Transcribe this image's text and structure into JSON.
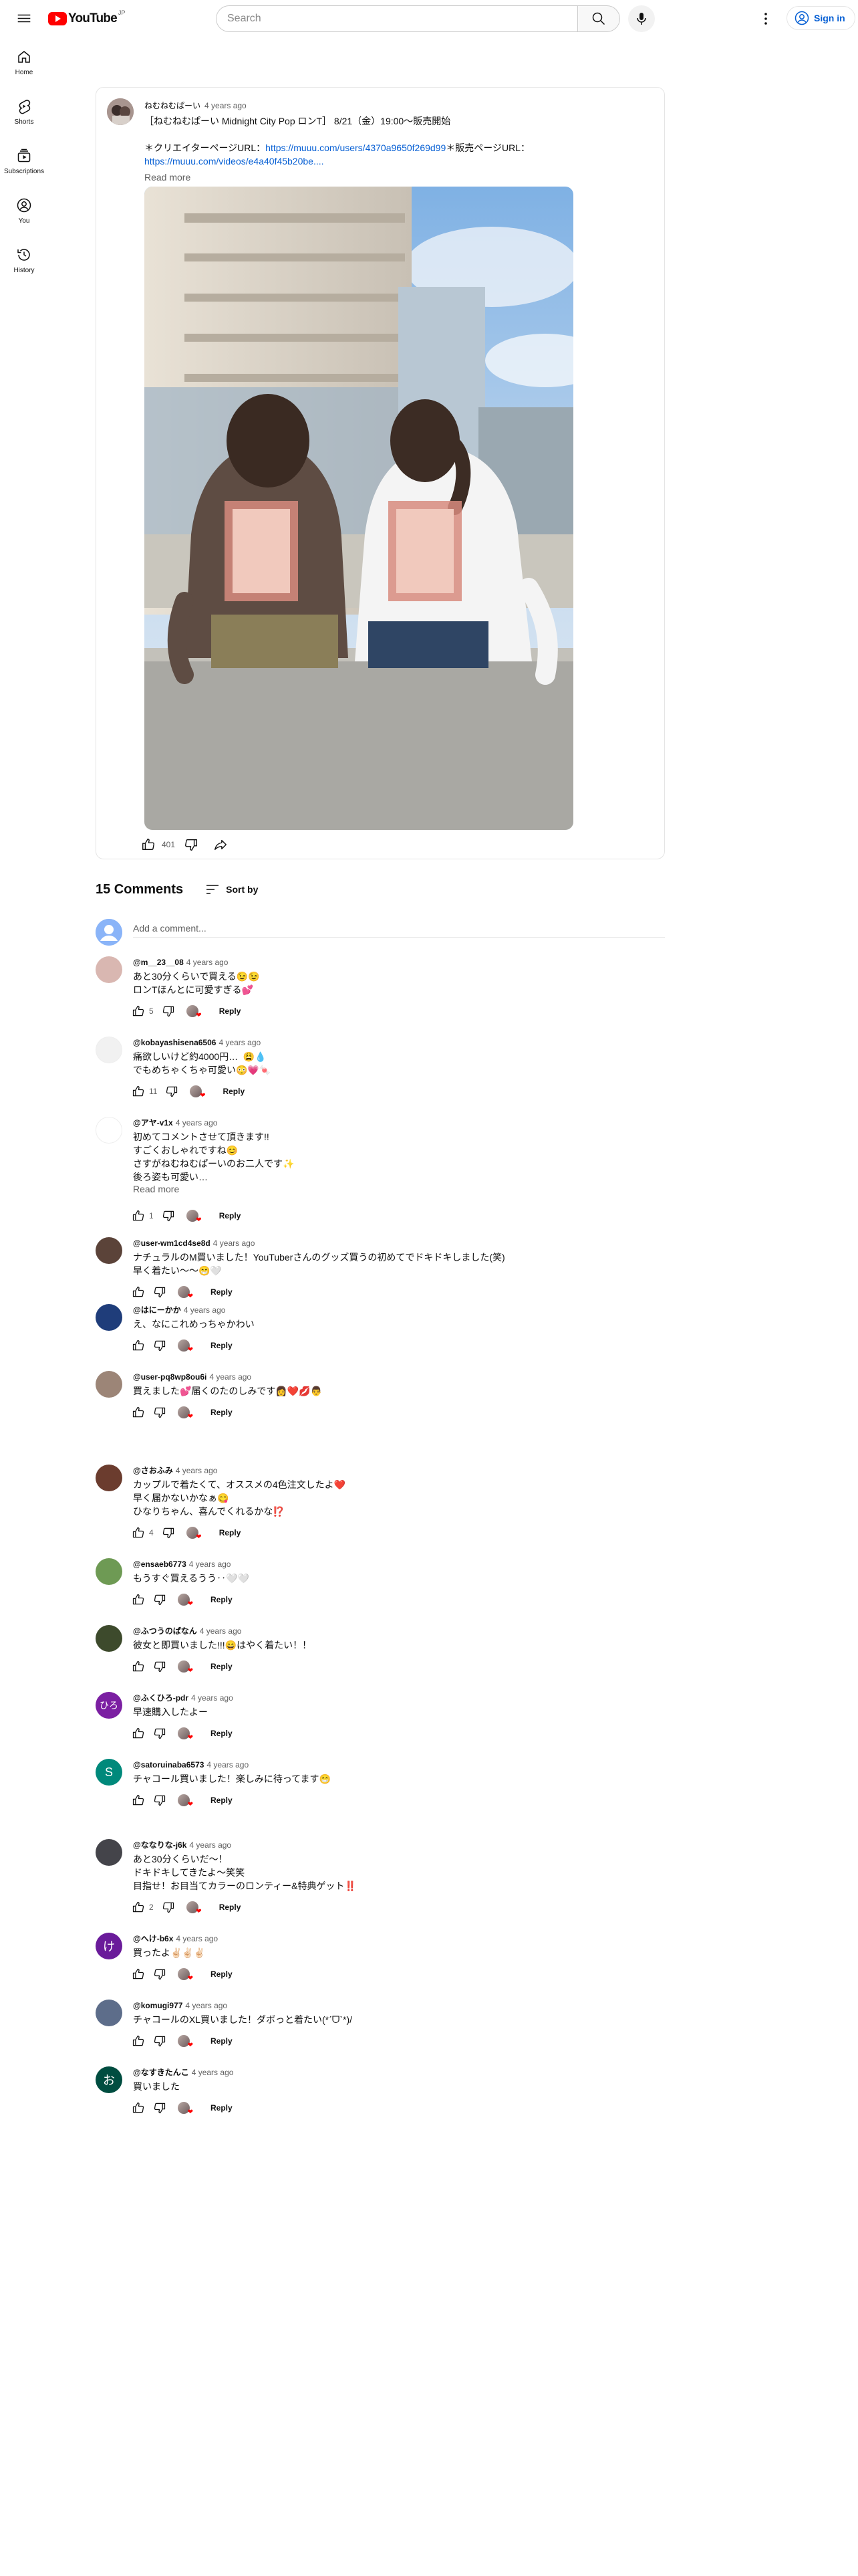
{
  "header": {
    "logo_text": "YouTube",
    "country": "JP",
    "search_placeholder": "Search",
    "signin_label": "Sign in"
  },
  "sidebar": {
    "items": [
      {
        "label": "Home",
        "icon": "home-icon"
      },
      {
        "label": "Shorts",
        "icon": "shorts-icon"
      },
      {
        "label": "Subscriptions",
        "icon": "subscriptions-icon"
      },
      {
        "label": "You",
        "icon": "you-icon"
      },
      {
        "label": "History",
        "icon": "history-icon"
      }
    ]
  },
  "post": {
    "author": "ねむねむぱーい",
    "time": "4 years ago",
    "title": "［ねむねむぱーい Midnight City Pop ロンT］ 8/21（金）19:00〜販売開始",
    "line2_prefix": "＊クリエイターページURL：",
    "link1": "https://muuu.com/users/4370a9650f269d99",
    "line2_suffix": "＊販売ページURL：",
    "link2": "https://muuu.com/videos/e4a40f45b20be....",
    "read_more": "Read more",
    "like_count": "401"
  },
  "comments_section": {
    "count_label": "15 Comments",
    "sort_label": "Sort by",
    "add_placeholder": "Add a comment..."
  },
  "comments": [
    {
      "handle": "@m__23__08",
      "time": "4 years ago",
      "text": "あと30分くらいで買える😉😉\nロンTほんとに可愛すぎる💕",
      "likes": "5",
      "reply": "Reply",
      "avatar_color": "#d9b7b1",
      "avatar_letter": ""
    },
    {
      "handle": "@kobayashisena6506",
      "time": "4 years ago",
      "text": "痛欲しいけど約4000円…  😩💧\nでもめちゃくちゃ可愛い😳💗🍬",
      "likes": "11",
      "reply": "Reply",
      "avatar_color": "#f1f1f1",
      "avatar_letter": ""
    },
    {
      "handle": "@アヤ-v1x",
      "time": "4 years ago",
      "text": "初めてコメントさせて頂きます!!\nすごくおしゃれですね😊\nさすがねむねむぱーいのお二人です✨\n後ろ姿も可愛い…",
      "read_more": "Read more",
      "likes": "1",
      "reply": "Reply",
      "avatar_color": "#ffffff",
      "avatar_letter": ""
    },
    {
      "handle": "@user-wm1cd4se8d",
      "time": "4 years ago",
      "text": "ナチュラルのM買いました！YouTuberさんのグッズ買うの初めてでドキドキしました(笑)\n早く着たい〜〜😁🤍",
      "likes": "",
      "reply": "Reply",
      "avatar_color": "#5b4339",
      "avatar_letter": ""
    },
    {
      "handle": "@はにーかか",
      "time": "4 years ago",
      "text": "え、なにこれめっちゃかわい",
      "likes": "",
      "reply": "Reply",
      "avatar_color": "#1f3d7a",
      "avatar_letter": ""
    },
    {
      "handle": "@user-pq8wp8ou6i",
      "time": "4 years ago",
      "text": "買えました💕届くのたのしみです👩❤️💋👨",
      "likes": "",
      "reply": "Reply",
      "avatar_color": "#9c8577",
      "avatar_letter": ""
    },
    {
      "handle": "@さおふみ",
      "time": "4 years ago",
      "text": "カップルで着たくて、オススメの4色注文したよ❤️\n早く届かないかなぁ😋\nひなりちゃん、喜んでくれるかな⁉️",
      "likes": "4",
      "reply": "Reply",
      "avatar_color": "#6b3c2e",
      "avatar_letter": ""
    },
    {
      "handle": "@ensaeb6773",
      "time": "4 years ago",
      "text": "もうすぐ買えるうう‥🤍🤍",
      "likes": "",
      "reply": "Reply",
      "avatar_color": "#6e9a54",
      "avatar_letter": ""
    },
    {
      "handle": "@ふつうのぱなん",
      "time": "4 years ago",
      "text": "彼女と即買いました!!!😄はやく着たい！！",
      "likes": "",
      "reply": "Reply",
      "avatar_color": "#3d4a2c",
      "avatar_letter": ""
    },
    {
      "handle": "@ふくひろ-pdr",
      "time": "4 years ago",
      "text": "早速購入したよー",
      "likes": "",
      "reply": "Reply",
      "avatar_color": "#7b1fa2",
      "avatar_letter": "ひろ"
    },
    {
      "handle": "@satoruinaba6573",
      "time": "4 years ago",
      "text": "チャコール買いました！楽しみに待ってます😁",
      "likes": "",
      "reply": "Reply",
      "avatar_color": "#00897b",
      "avatar_letter": "S"
    },
    {
      "handle": "@ななりな-j6k",
      "time": "4 years ago",
      "text": "あと30分くらいだ〜！\nドキドキしてきたよ〜笑笑\n目指せ！お目当てカラーのロンティー&特典ゲット‼️",
      "likes": "2",
      "reply": "Reply",
      "avatar_color": "#44444a",
      "avatar_letter": ""
    },
    {
      "handle": "@へけ-b6x",
      "time": "4 years ago",
      "text": "買ったよ✌🏻✌🏻✌🏻",
      "likes": "",
      "reply": "Reply",
      "avatar_color": "#6a1b9a",
      "avatar_letter": "け"
    },
    {
      "handle": "@komugi977",
      "time": "4 years ago",
      "text": "チャコールのXL買いました！ダボっと着たい(*ˊᗜˋ*)/",
      "likes": "",
      "reply": "Reply",
      "avatar_color": "#5d6d8a",
      "avatar_letter": ""
    },
    {
      "handle": "@なすきたんこ",
      "time": "4 years ago",
      "text": "買いました",
      "likes": "",
      "reply": "Reply",
      "avatar_color": "#004d40",
      "avatar_letter": "お"
    }
  ]
}
